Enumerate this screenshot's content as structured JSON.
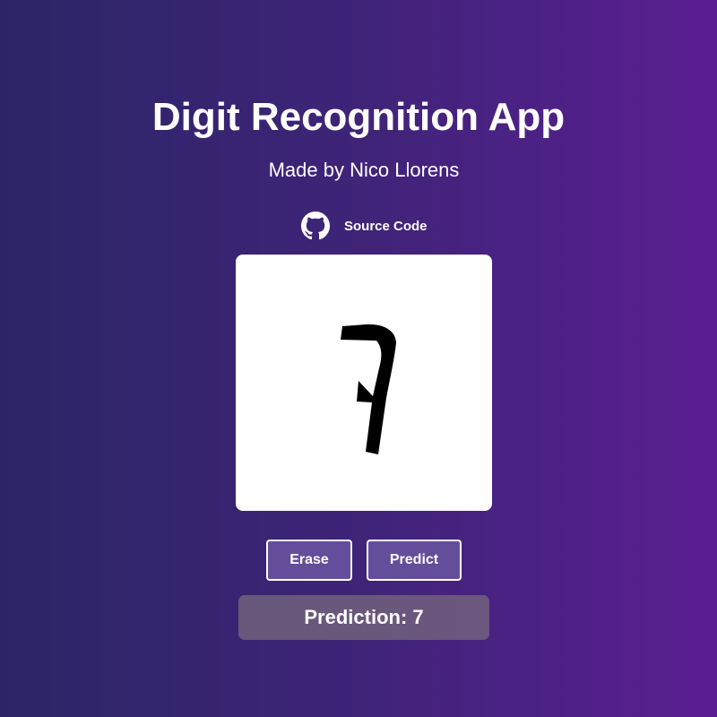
{
  "header": {
    "title": "Digit Recognition App",
    "subtitle": "Made by Nico Llorens"
  },
  "source_link": {
    "label": "Source Code",
    "icon": "github-icon"
  },
  "canvas": {
    "drawn_digit": "7"
  },
  "controls": {
    "erase_label": "Erase",
    "predict_label": "Predict"
  },
  "result": {
    "prediction_text": "Prediction: 7"
  },
  "colors": {
    "background_start": "#2b2567",
    "background_end": "#5a1e93",
    "button_fill": "#644d9a",
    "canvas": "#ffffff"
  }
}
